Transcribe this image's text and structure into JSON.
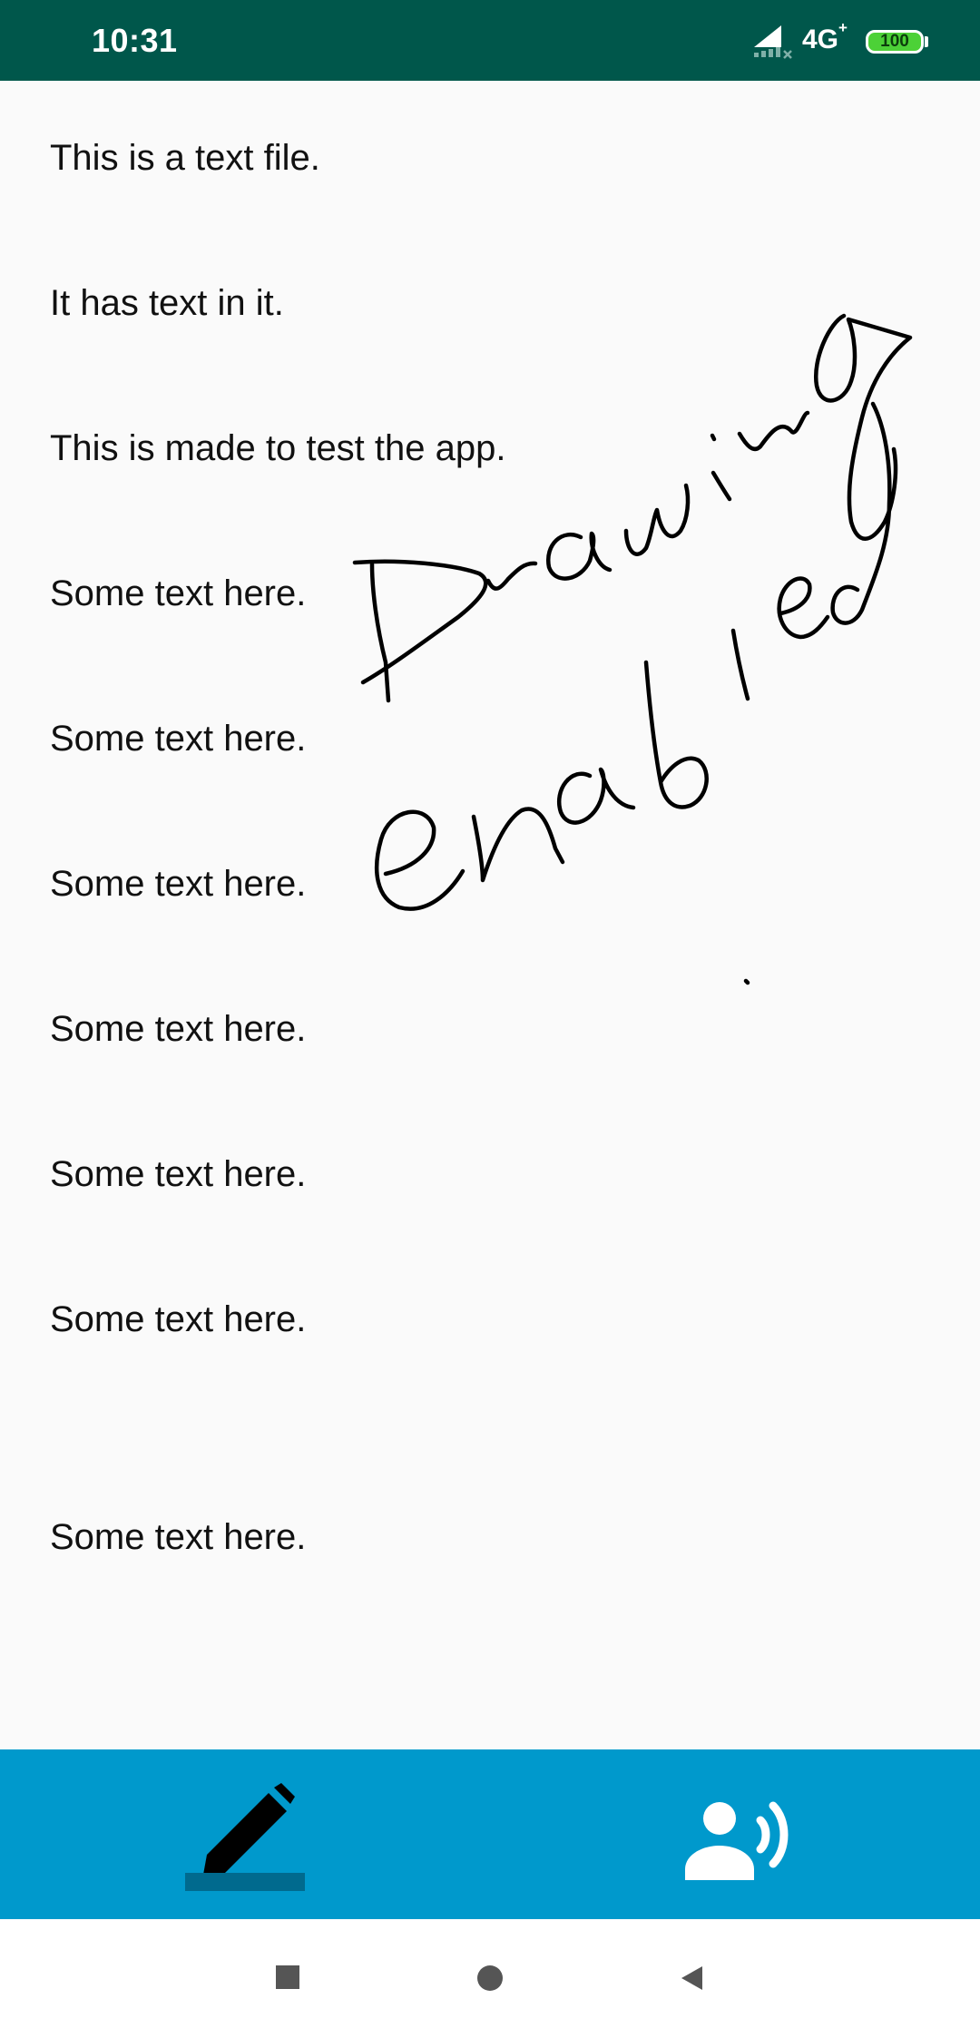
{
  "status_bar": {
    "time": "10:31",
    "network": "4G",
    "network_plus": "+",
    "battery": "100",
    "background_color": "#00574b"
  },
  "document": {
    "lines": [
      "This is a text file.",
      "It has text in it.",
      "This is made to test the app.",
      "Some text here.",
      "Some text here.",
      "Some text here.",
      "Some text here.",
      "Some text here.",
      "Some text here.",
      "Some text here."
    ]
  },
  "drawing": {
    "handwriting_text": "Drawing enabled",
    "stroke_color": "#000000"
  },
  "toolbar": {
    "background_color": "#0099cc",
    "buttons": [
      {
        "icon": "pencil-icon",
        "active": true
      },
      {
        "icon": "speaker-icon",
        "active": false
      }
    ]
  },
  "nav_bar": {
    "buttons": [
      "recents-icon",
      "home-icon",
      "back-icon"
    ]
  }
}
